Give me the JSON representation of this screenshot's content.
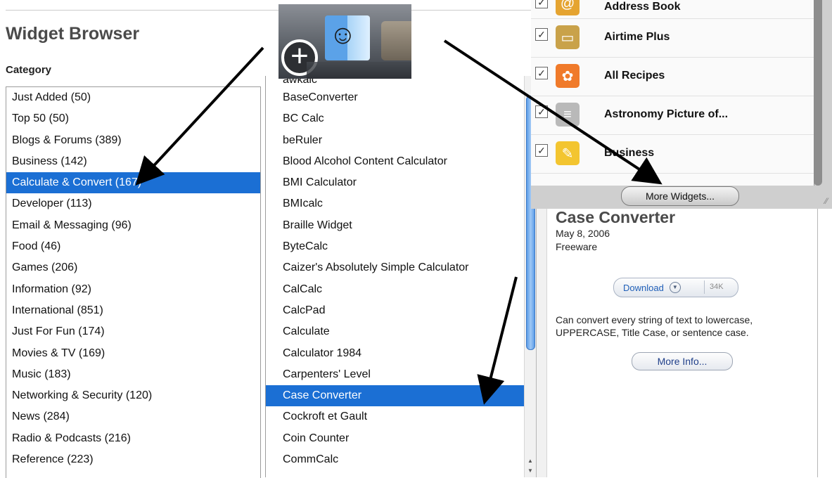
{
  "page": {
    "title": "Widget Browser",
    "category_label": "Category"
  },
  "categories": [
    "Just Added (50)",
    "Top 50 (50)",
    "Blogs & Forums (389)",
    "Business (142)",
    "Calculate & Convert (167)",
    "Developer (113)",
    "Email & Messaging (96)",
    "Food (46)",
    "Games (206)",
    "Information (92)",
    "International (851)",
    "Just For Fun (174)",
    "Movies & TV (169)",
    "Music (183)",
    "Networking & Security (120)",
    "News (284)",
    "Radio & Podcasts (216)",
    "Reference (223)"
  ],
  "selected_category_index": 4,
  "widgets": [
    "awkalc",
    "BaseConverter",
    "BC Calc",
    "beRuler",
    "Blood Alcohol Content Calculator",
    "BMI Calculator",
    "BMIcalc",
    "Braille Widget",
    "ByteCalc",
    "Caizer's Absolutely Simple Calculator",
    "CalCalc",
    "CalcPad",
    "Calculate",
    "Calculator 1984",
    "Carpenters' Level",
    "Case Converter",
    "Cockroft et Gault",
    "Coin Counter",
    "CommCalc"
  ],
  "selected_widget_index": 15,
  "detail": {
    "name": "Case Converter",
    "date": "May 8, 2006",
    "license": "Freeware",
    "download_label": "Download",
    "download_size": "34K",
    "description": "Can convert every string of text to lowercase, UPPERCASE, Title Case, or sentence case.",
    "more_info_label": "More Info..."
  },
  "widgets_panel": {
    "items": [
      {
        "name": "Address Book",
        "icon": "at-sign-icon",
        "color": "#e5a431"
      },
      {
        "name": "Airtime Plus",
        "icon": "tv-icon",
        "color": "#c9a24a"
      },
      {
        "name": "All Recipes",
        "icon": "recipes-icon",
        "color": "#f07a2a"
      },
      {
        "name": "Astronomy Picture of...",
        "icon": "astronomy-icon",
        "color": "#b9b9b9"
      },
      {
        "name": "Business",
        "icon": "business-icon",
        "color": "#f3c530"
      }
    ],
    "more_widgets_label": "More Widgets..."
  },
  "colors": {
    "selection": "#1b6fd4",
    "title_gray": "#4a4a4a"
  }
}
